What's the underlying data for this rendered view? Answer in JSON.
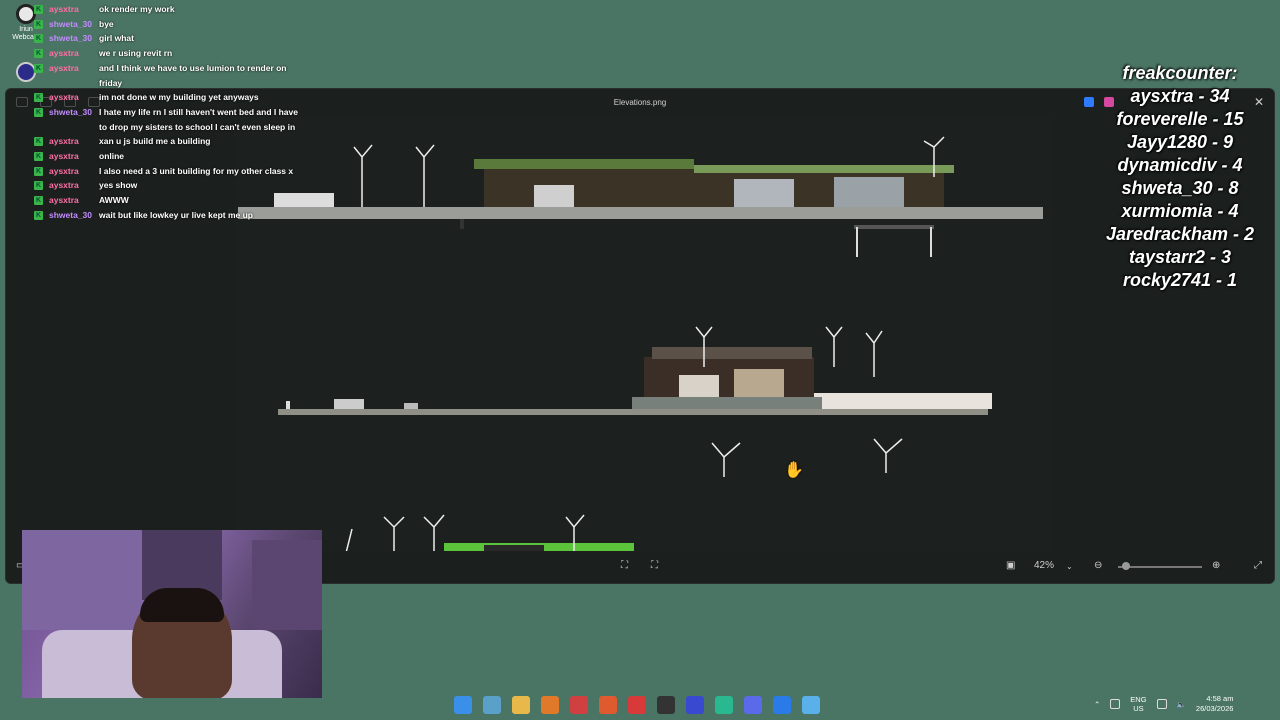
{
  "desktop": {
    "icons": [
      {
        "label": "Iriun Webcam",
        "icon": "webcam-icon"
      },
      {
        "label": "",
        "icon": "obs-icon"
      }
    ]
  },
  "viewer": {
    "title": "Elevations.png",
    "zoom": "42%",
    "zoom_fraction": 0.05
  },
  "chat": [
    {
      "user": "aysxtra",
      "text": "ok render my work",
      "color": "pink"
    },
    {
      "user": "shweta_30",
      "text": "bye",
      "color": "purple"
    },
    {
      "user": "shweta_30",
      "text": "girl what",
      "color": "purple"
    },
    {
      "user": "aysxtra",
      "text": "we r using revit rn",
      "color": "pink"
    },
    {
      "user": "aysxtra",
      "text": "and I think we have to use lumion to render on friday",
      "color": "pink"
    },
    {
      "user": "aysxtra",
      "text": "im not done w my building yet anyways",
      "color": "pink"
    },
    {
      "user": "shweta_30",
      "text": "I hate my life rn I still haven't went bed and I have to drop my sisters to school I can't even sleep in",
      "color": "purple"
    },
    {
      "user": "aysxtra",
      "text": "xan u js build me a building",
      "color": "pink"
    },
    {
      "user": "aysxtra",
      "text": "online",
      "color": "pink"
    },
    {
      "user": "aysxtra",
      "text": "I also need a 3 unit building for my other class x",
      "color": "pink"
    },
    {
      "user": "aysxtra",
      "text": "yes show",
      "color": "pink"
    },
    {
      "user": "aysxtra",
      "text": "AWWW",
      "color": "pink"
    },
    {
      "user": "shweta_30",
      "text": "wait but like lowkey ur live kept me up",
      "color": "purple"
    }
  ],
  "counter": {
    "title": "freakcounter:",
    "entries": [
      "aysxtra - 34",
      "foreverelle - 15",
      "Jayy1280 - 9",
      "dynamicdiv - 4",
      "shweta_30 - 8",
      "xurmiomia - 4",
      "Jaredrackham - 2",
      "taystarr2 - 3",
      "rocky2741 - 1"
    ]
  },
  "taskbar": {
    "icons": [
      "windows-start-icon",
      "task-view-icon",
      "file-explorer-icon",
      "blender-icon",
      "revit-icon",
      "brave-icon",
      "app-red-icon",
      "figma-icon",
      "obs-taskbar-icon",
      "app-green-icon",
      "discord-icon",
      "app-blue-icon",
      "photos-icon"
    ],
    "lang_top": "ENG",
    "lang_bottom": "US",
    "time": "4:58 am",
    "date": "26/03/2026"
  },
  "colors": {
    "desktop": "#4a7463",
    "viewer_bg": "#1b1f1e",
    "chat_pink": "#ff6fa5",
    "chat_purple": "#c28cff",
    "badge_green": "#3ab54a"
  }
}
